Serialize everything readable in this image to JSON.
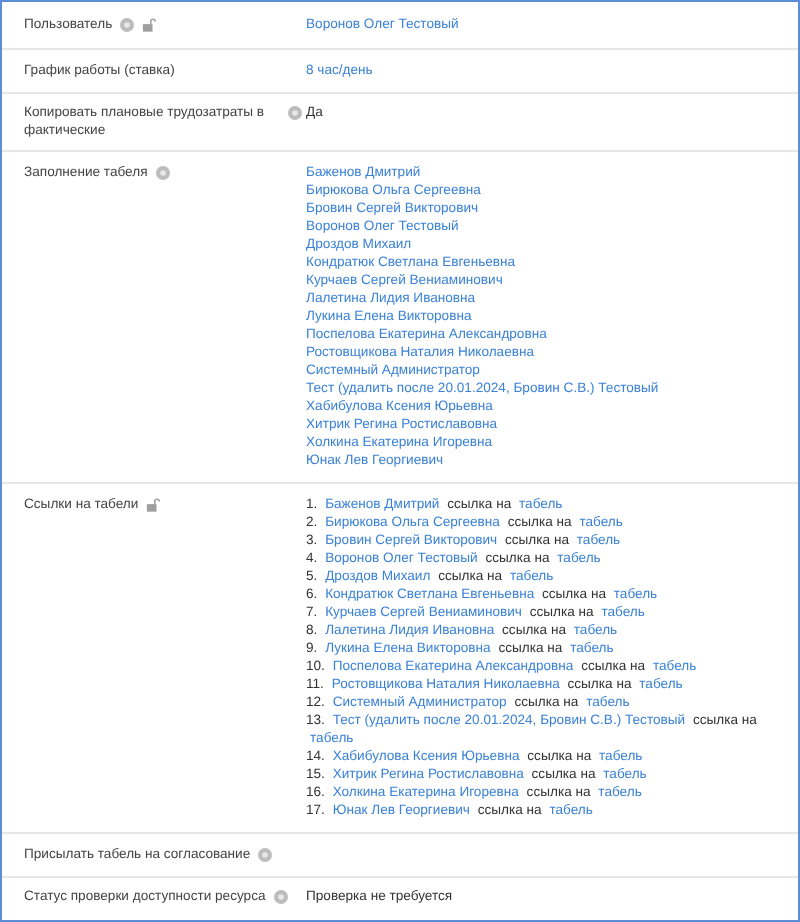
{
  "rows": [
    {
      "label": "Пользователь",
      "help": true,
      "lock": true,
      "kind": "link",
      "value": "Воронов Олег Тестовый"
    },
    {
      "label": "График работы (ставка)",
      "help": false,
      "lock": false,
      "kind": "link",
      "value": "8 час/день"
    },
    {
      "label": "Копировать плановые трудозатраты в фактические",
      "help": true,
      "lock": false,
      "kind": "text",
      "value": "Да"
    },
    {
      "label": "Заполнение табеля",
      "help": true,
      "lock": false,
      "kind": "links",
      "items": [
        "Баженов Дмитрий",
        "Бирюкова Ольга Сергеевна",
        "Бровин Сергей Викторович",
        "Воронов Олег Тестовый",
        "Дроздов Михаил",
        "Кондратюк Светлана Евгеньевна",
        "Курчаев Сергей Вениаминович",
        "Лалетина Лидия Ивановна",
        "Лукина Елена Викторовна",
        "Поспелова Екатерина Александровна",
        "Ростовщикова Наталия Николаевна",
        "Системный Администратор",
        "Тест (удалить после 20.01.2024, Бровин С.В.) Тестовый",
        "Хабибулова Ксения Юрьевна",
        "Хитрик Регина Ростиславовна",
        "Холкина Екатерина Игоревна",
        "Юнак Лев Георгиевич"
      ]
    },
    {
      "label": "Ссылки на табели",
      "help": false,
      "lock": true,
      "kind": "references",
      "items": [
        {
          "number": "1.",
          "name": "Баженов Дмитрий",
          "text": "ссылка на",
          "link": "табель"
        },
        {
          "number": "2.",
          "name": "Бирюкова Ольга Сергеевна",
          "text": "ссылка на",
          "link": "табель"
        },
        {
          "number": "3.",
          "name": "Бровин Сергей Викторович",
          "text": "ссылка на",
          "link": "табель"
        },
        {
          "number": "4.",
          "name": "Воронов Олег Тестовый",
          "text": "ссылка на",
          "link": "табель"
        },
        {
          "number": "5.",
          "name": "Дроздов Михаил",
          "text": "ссылка на",
          "link": "табель"
        },
        {
          "number": "6.",
          "name": "Кондратюк Светлана Евгеньевна",
          "text": "ссылка на",
          "link": "табель"
        },
        {
          "number": "7.",
          "name": "Курчаев Сергей Вениаминович",
          "text": "ссылка на",
          "link": "табель"
        },
        {
          "number": "8.",
          "name": "Лалетина Лидия Ивановна",
          "text": "ссылка на",
          "link": "табель"
        },
        {
          "number": "9.",
          "name": "Лукина Елена Викторовна",
          "text": "ссылка на",
          "link": "табель"
        },
        {
          "number": "10.",
          "name": "Поспелова Екатерина Александровна",
          "text": "ссылка на",
          "link": "табель"
        },
        {
          "number": "11.",
          "name": "Ростовщикова Наталия Николаевна",
          "text": "ссылка на",
          "link": "табель"
        },
        {
          "number": "12.",
          "name": "Системный Администратор",
          "text": "ссылка на",
          "link": "табель"
        },
        {
          "number": "13.",
          "name": "Тест (удалить после 20.01.2024, Бровин С.В.) Тестовый",
          "text": "ссылка на",
          "link": "табель"
        },
        {
          "number": "14.",
          "name": "Хабибулова Ксения Юрьевна",
          "text": "ссылка на",
          "link": "табель"
        },
        {
          "number": "15.",
          "name": "Хитрик Регина Ростиславовна",
          "text": "ссылка на",
          "link": "табель"
        },
        {
          "number": "16.",
          "name": "Холкина Екатерина Игоревна",
          "text": "ссылка на",
          "link": "табель"
        },
        {
          "number": "17.",
          "name": "Юнак Лев Георгиевич",
          "text": "ссылка на",
          "link": "табель"
        }
      ]
    },
    {
      "label": "Присылать табель на согласование",
      "help": true,
      "lock": false,
      "kind": "empty"
    },
    {
      "label": "Статус проверки доступности ресурса",
      "help": true,
      "lock": false,
      "kind": "text",
      "value": "Проверка не требуется"
    }
  ]
}
